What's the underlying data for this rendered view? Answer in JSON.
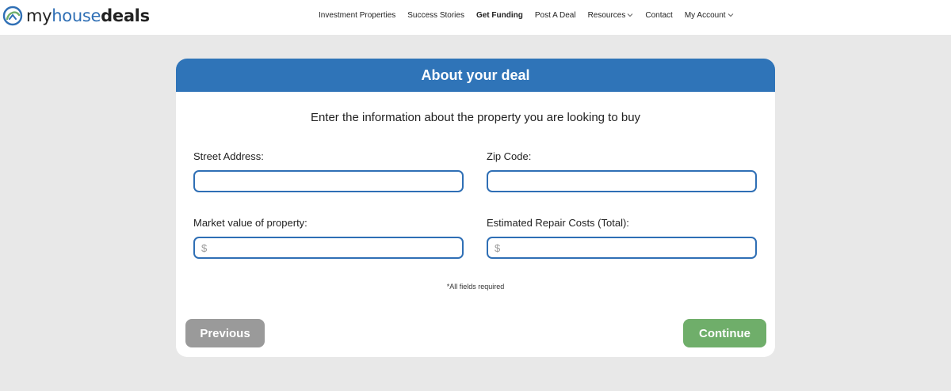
{
  "header": {
    "logo": {
      "part_my": "my",
      "part_house": "house",
      "part_deals": "deals",
      "icon": "house-circle-logo-icon"
    },
    "nav": [
      {
        "label": "Investment Properties",
        "bold": false,
        "dropdown": false
      },
      {
        "label": "Success Stories",
        "bold": false,
        "dropdown": false
      },
      {
        "label": "Get Funding",
        "bold": true,
        "dropdown": false
      },
      {
        "label": "Post A Deal",
        "bold": false,
        "dropdown": false
      },
      {
        "label": "Resources",
        "bold": false,
        "dropdown": true
      },
      {
        "label": "Contact",
        "bold": false,
        "dropdown": false
      },
      {
        "label": "My Account",
        "bold": false,
        "dropdown": true
      }
    ]
  },
  "form": {
    "title": "About your deal",
    "subtitle": "Enter the information about the property you are looking to buy",
    "street_address": {
      "label": "Street Address:",
      "value": ""
    },
    "zip_code": {
      "label": "Zip Code:",
      "value": ""
    },
    "market_value": {
      "label": "Market value of property:",
      "prefix": "$",
      "value": ""
    },
    "repair_costs": {
      "label": "Estimated Repair Costs (Total):",
      "prefix": "$",
      "value": ""
    },
    "required_note": "*All fields required",
    "previous_label": "Previous",
    "continue_label": "Continue"
  },
  "colors": {
    "brand_blue": "#2f74b8",
    "continue_green": "#6fae6a",
    "previous_gray": "#9a9a9a",
    "page_background": "#e8e8e8"
  }
}
